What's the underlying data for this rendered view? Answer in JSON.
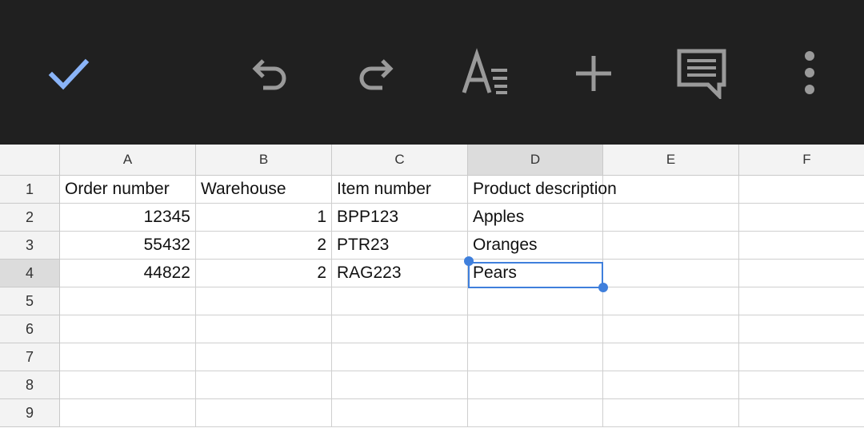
{
  "toolbar": {
    "icons": [
      "check-icon",
      "undo-icon",
      "redo-icon",
      "text-format-icon",
      "insert-icon",
      "comment-icon",
      "more-vert-icon"
    ],
    "accent": "#8ab4f8"
  },
  "columns": [
    "A",
    "B",
    "C",
    "D",
    "E",
    "F"
  ],
  "rows": [
    {
      "num": "1",
      "cells": [
        "Order number",
        "Warehouse",
        "Item number",
        "Product description",
        "",
        ""
      ]
    },
    {
      "num": "2",
      "cells": [
        "12345",
        "1",
        "BPP123",
        "Apples",
        "",
        ""
      ]
    },
    {
      "num": "3",
      "cells": [
        "55432",
        "2",
        "PTR23",
        "Oranges",
        "",
        ""
      ]
    },
    {
      "num": "4",
      "cells": [
        "44822",
        "2",
        "RAG223",
        "Pears",
        "",
        ""
      ]
    },
    {
      "num": "5",
      "cells": [
        "",
        "",
        "",
        "",
        "",
        ""
      ]
    },
    {
      "num": "6",
      "cells": [
        "",
        "",
        "",
        "",
        "",
        ""
      ]
    },
    {
      "num": "7",
      "cells": [
        "",
        "",
        "",
        "",
        "",
        ""
      ]
    },
    {
      "num": "8",
      "cells": [
        "",
        "",
        "",
        "",
        "",
        ""
      ]
    },
    {
      "num": "9",
      "cells": [
        "",
        "",
        "",
        "",
        "",
        ""
      ]
    }
  ],
  "selection": {
    "cell": "D4",
    "color": "#3f7fdc"
  }
}
